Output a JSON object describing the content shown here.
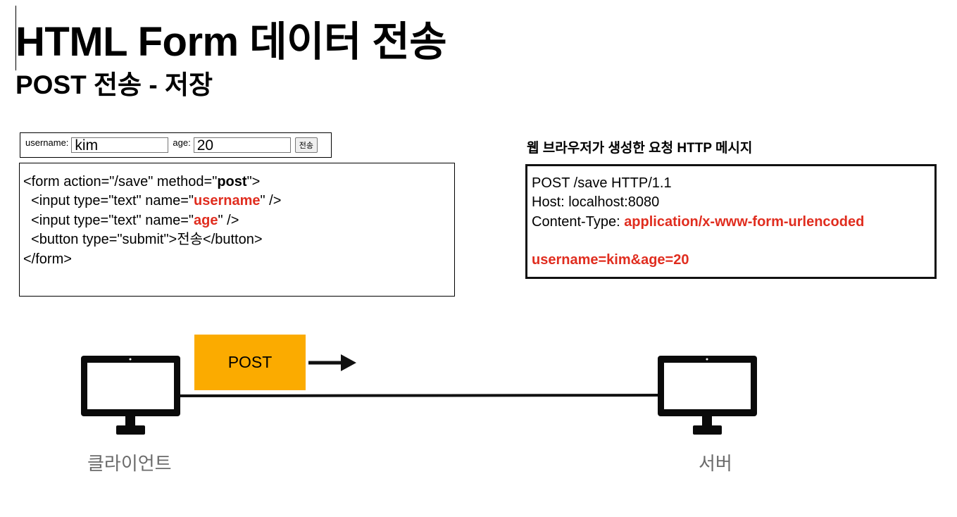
{
  "title": "HTML Form 데이터 전송",
  "subtitle": "POST 전송 - 저장",
  "form_preview": {
    "username_label": "username:",
    "username_value": "kim",
    "age_label": "age:",
    "age_value": "20",
    "submit_label": "전송"
  },
  "code": {
    "l1_a": "<form action=\"/save\" method=\"",
    "l1_method": "post",
    "l1_b": "\">",
    "l2_a": "  <input type=\"text\" name=\"",
    "l2_name": "username",
    "l2_b": "\" />",
    "l3_a": "  <input type=\"text\" name=\"",
    "l3_name": "age",
    "l3_b": "\" />",
    "l4": "  <button type=\"submit\">전송</button>",
    "l5": "</form>"
  },
  "http": {
    "caption_a": "웹 브라우저가 생성한 요청 ",
    "caption_b": "HTTP",
    "caption_c": " 메시지",
    "request_line": "POST /save HTTP/1.1",
    "host_line": "Host: localhost:8080",
    "content_type_label": "Content-Type: ",
    "content_type_value": "application/x-www-form-urlencoded",
    "body": "username=kim&age=20"
  },
  "diagram": {
    "method_label": "POST",
    "client_label": "클라이언트",
    "server_label": "서버",
    "icon": "desktop-monitor-icon",
    "accent_color": "#fbab00",
    "highlight_color": "#e02d1f"
  }
}
